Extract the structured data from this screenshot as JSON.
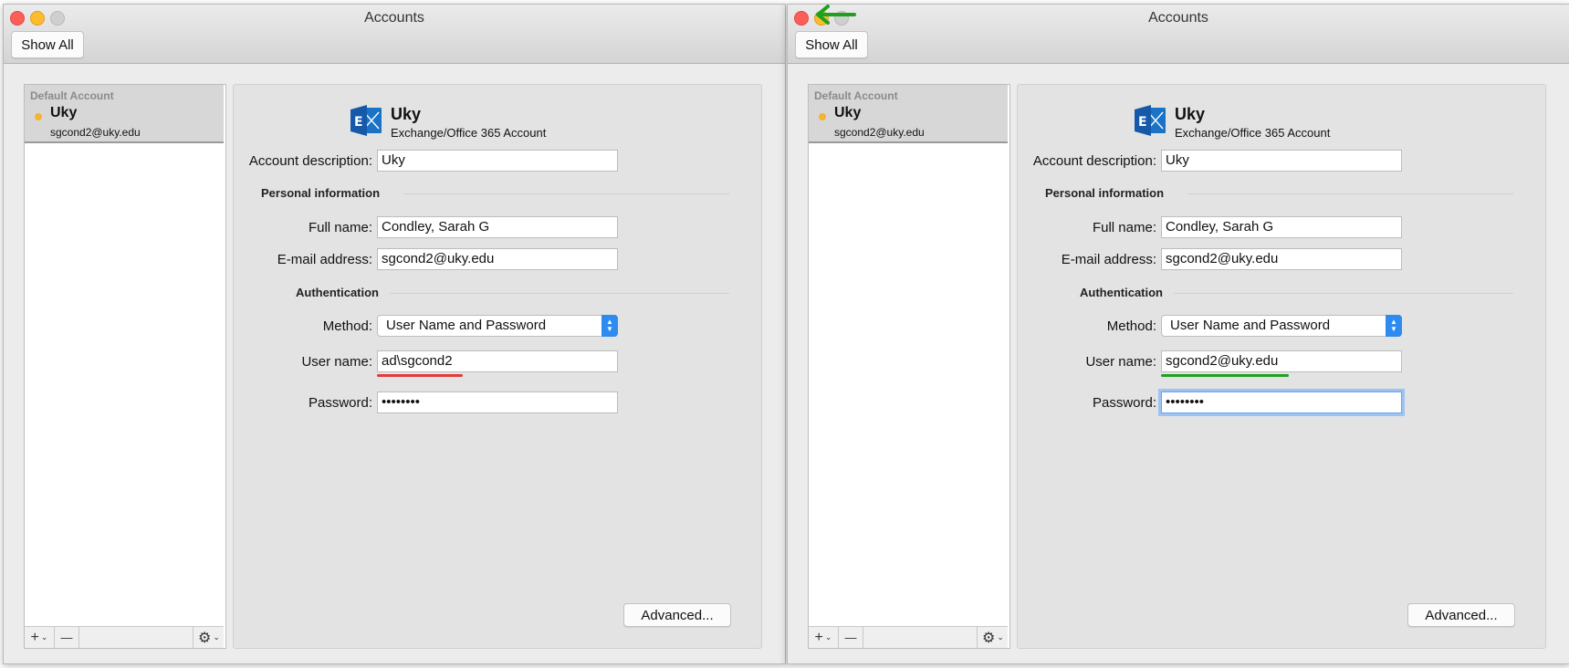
{
  "windows": [
    {
      "title": "Accounts",
      "show_all_label": "Show All",
      "account_list": {
        "section_label": "Default Account",
        "account_name": "Uky",
        "account_email": "sgcond2@uky.edu",
        "add_label": "+",
        "remove_label": "—",
        "settings_label": "⚙"
      },
      "detail": {
        "account_name": "Uky",
        "account_type": "Exchange/Office 365 Account",
        "account_description_label": "Account description:",
        "account_description_value": "Uky",
        "personal_info_label": "Personal information",
        "full_name_label": "Full name:",
        "full_name_value": "Condley, Sarah G",
        "email_label": "E-mail address:",
        "email_value": "sgcond2@uky.edu",
        "authentication_label": "Authentication",
        "method_label": "Method:",
        "method_value": "User Name and Password",
        "username_label": "User name:",
        "username_value": "ad\\sgcond2",
        "password_label": "Password:",
        "password_value": "••••••••",
        "advanced_label": "Advanced..."
      },
      "username_underline_color": "#e33a3a"
    },
    {
      "title": "Accounts",
      "show_all_label": "Show All",
      "account_list": {
        "section_label": "Default Account",
        "account_name": "Uky",
        "account_email": "sgcond2@uky.edu",
        "add_label": "+",
        "remove_label": "—",
        "settings_label": "⚙"
      },
      "detail": {
        "account_name": "Uky",
        "account_type": "Exchange/Office 365 Account",
        "account_description_label": "Account description:",
        "account_description_value": "Uky",
        "personal_info_label": "Personal information",
        "full_name_label": "Full name:",
        "full_name_value": "Condley, Sarah G",
        "email_label": "E-mail address:",
        "email_value": "sgcond2@uky.edu",
        "authentication_label": "Authentication",
        "method_label": "Method:",
        "method_value": "User Name and Password",
        "username_label": "User name:",
        "username_value": "sgcond2@uky.edu",
        "password_label": "Password:",
        "password_value": "••••••••",
        "advanced_label": "Advanced..."
      },
      "username_underline_color": "#1fa11f",
      "annotation_arrow_color": "#1fa11f"
    }
  ]
}
